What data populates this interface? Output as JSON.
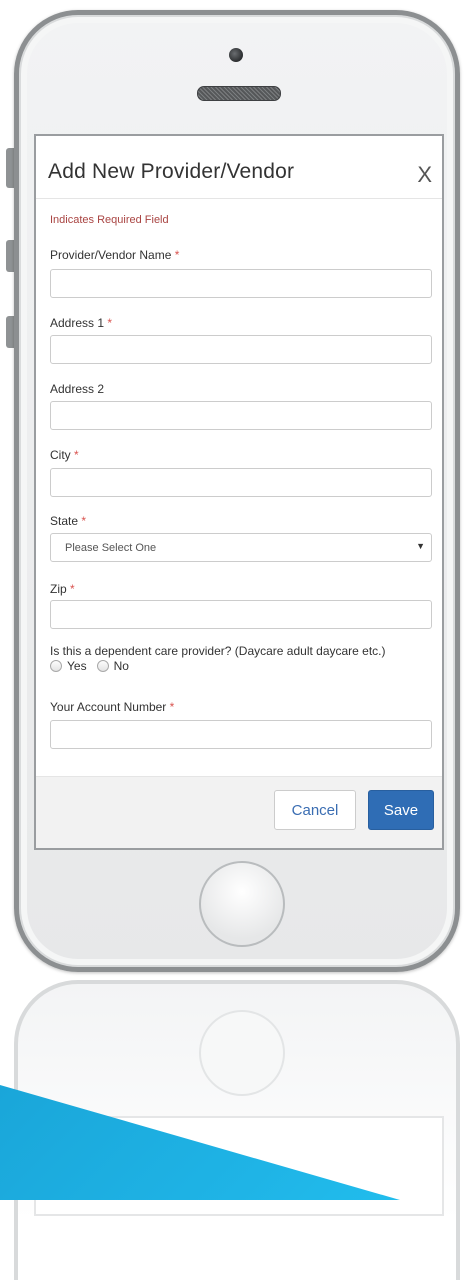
{
  "modal": {
    "title": "Add New Provider/Vendor",
    "close_label": "X",
    "required_note": "Indicates Required Field"
  },
  "fields": {
    "provider_name": {
      "label": "Provider/Vendor Name",
      "required_mark": "*",
      "value": ""
    },
    "address1": {
      "label": "Address 1",
      "required_mark": "*",
      "value": ""
    },
    "address2": {
      "label": "Address 2",
      "value": ""
    },
    "city": {
      "label": "City",
      "required_mark": "*",
      "value": ""
    },
    "state": {
      "label": "State",
      "required_mark": "*",
      "selected": "Please Select One"
    },
    "zip": {
      "label": "Zip",
      "required_mark": "*",
      "value": ""
    },
    "dependent_care": {
      "question": "Is this a dependent care provider? (Daycare adult daycare etc.)",
      "options": [
        "Yes",
        "No"
      ]
    },
    "account_number": {
      "label": "Your Account Number",
      "required_mark": "*",
      "value": ""
    }
  },
  "footer": {
    "cancel_label": "Cancel",
    "save_label": "Save"
  },
  "colors": {
    "primary": "#2f6db5",
    "required": "#d9534f",
    "note": "#a94442",
    "accent_shape": "#1fb4e6"
  },
  "icons": {
    "close": "close-icon",
    "select_caret": "caret-down-icon"
  }
}
